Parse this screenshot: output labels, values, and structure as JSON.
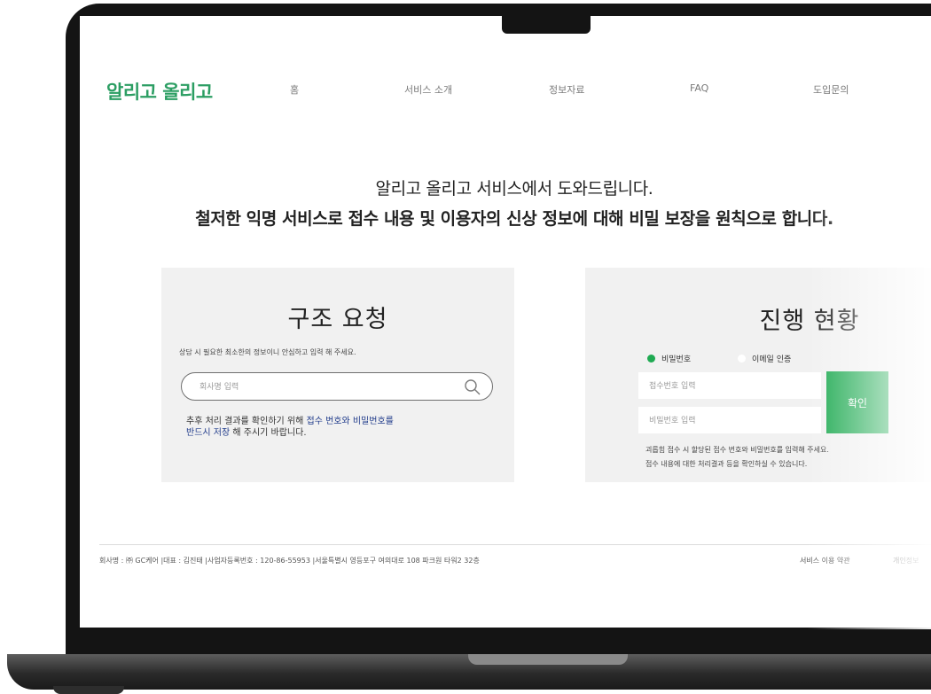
{
  "header": {
    "logo": "알리고 올리고",
    "nav": [
      "홈",
      "서비스 소개",
      "정보자료",
      "FAQ",
      "도입문의"
    ]
  },
  "hero": {
    "line1": "알리고 올리고 서비스에서 도와드립니다.",
    "line2": "철저한 익명 서비스로 접수 내용 및 이용자의 신상 정보에 대해 비밀 보장을 원칙으로 합니다."
  },
  "rescue": {
    "title": "구조 요청",
    "subtitle": "상담 시 필요한 최소한의 정보이니 안심하고 입력 해 주세요.",
    "company_placeholder": "회사명 입력",
    "notice_1a": "추후 처리 결과를 확인하기 위해 ",
    "notice_1b": "접수 번호와 비밀번호를",
    "notice_2a": "반드시 저장",
    "notice_2b": " 해 주시기 바랍니다."
  },
  "status": {
    "title": "진행 현황",
    "radio_password": "비밀번호",
    "radio_email": "이메일 인증",
    "receipt_placeholder": "접수번호 입력",
    "password_placeholder": "비밀번호 입력",
    "confirm_label": "확인",
    "help_1": "괴롭힘 접수 시 할당된 접수 번호와 비밀번호를 입력해 주세요.",
    "help_2": "접수 내용에 대한 처리결과 등을 확인하실 수 있습니다."
  },
  "footer": {
    "info": "회사명 : ㈜ GC케어   |대표 : 김진태   |사업자등록번호 : 120-86-55953   |서울특별시 영등포구 여의대로 108 파크원 타워2 32층",
    "terms": "서비스 이용 약관",
    "privacy": "개인정보"
  },
  "colors": {
    "brand_green": "#2c9e63",
    "button_green": "#1faa52",
    "panel_bg": "#f1f1f1",
    "highlight_blue": "#1f3a8a"
  }
}
